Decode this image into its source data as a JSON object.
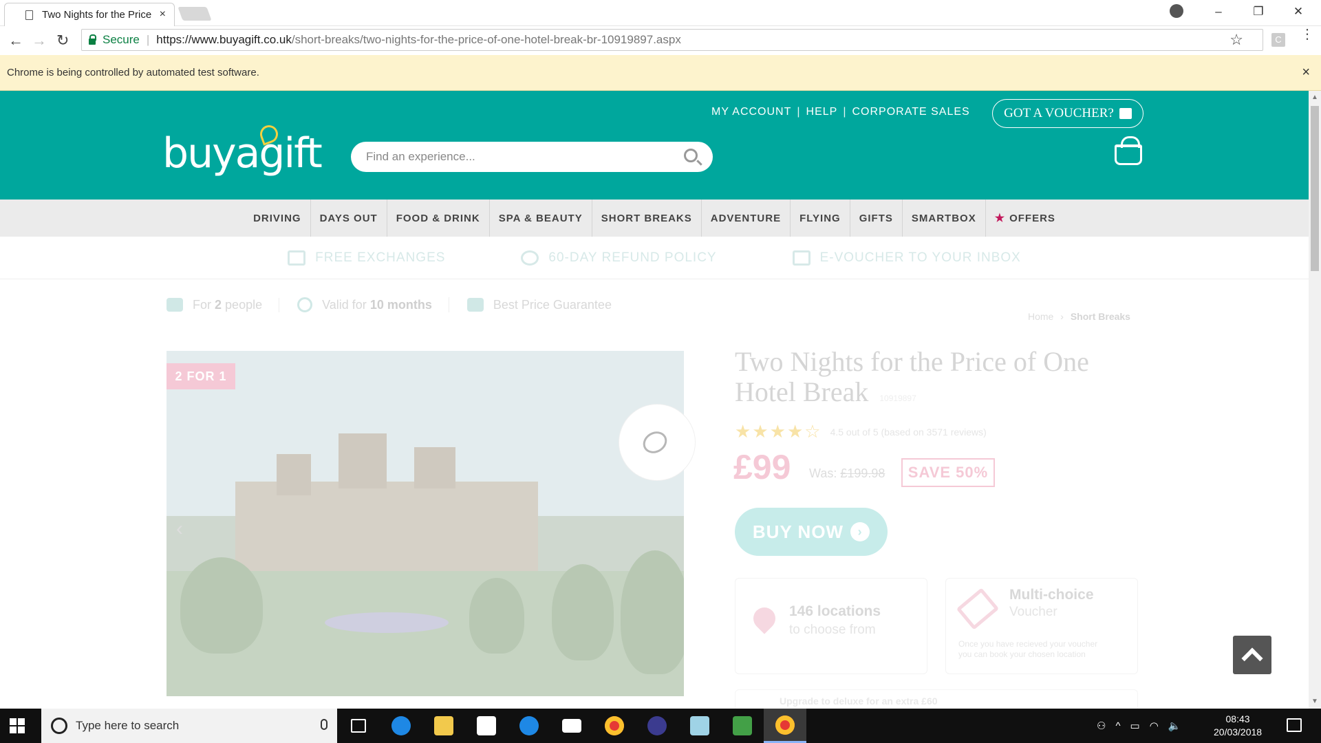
{
  "browser": {
    "tab_title": "Two Nights for the Price",
    "tab_close": "×",
    "secure_label": "Secure",
    "url_host": "https://www.buyagift.co.uk",
    "url_path": "/short-breaks/two-nights-for-the-price-of-one-hotel-break-br-10919897.aspx",
    "ext_label": "C",
    "infobar_text": "Chrome is being controlled by automated test software.",
    "infobar_close": "×",
    "window_controls": {
      "minimize": "–",
      "restore": "❐",
      "close": "✕"
    },
    "nav": {
      "back": "←",
      "forward": "→",
      "reload": "↻",
      "star": "☆"
    }
  },
  "header": {
    "top_links": [
      "MY ACCOUNT",
      "HELP",
      "CORPORATE SALES"
    ],
    "voucher_button": "GOT A VOUCHER?",
    "logo_text": "buyagift",
    "search_placeholder": "Find an experience..."
  },
  "categories": [
    "DRIVING",
    "DAYS OUT",
    "FOOD & DRINK",
    "SPA & BEAUTY",
    "SHORT BREAKS",
    "ADVENTURE",
    "FLYING",
    "GIFTS",
    "SMARTBOX",
    "OFFERS"
  ],
  "usps": [
    "FREE EXCHANGES",
    "60-DAY REFUND POLICY",
    "E-VOUCHER TO YOUR INBOX"
  ],
  "meta": {
    "people_prefix": "For",
    "people_count": "2",
    "people_suffix": "people",
    "valid_prefix": "Valid for",
    "valid_value": "10 months",
    "price_guarantee": "Best Price Guarantee"
  },
  "breadcrumb": {
    "home": "Home",
    "sep": "›",
    "current": "Short Breaks"
  },
  "product": {
    "badge": "2 FOR 1",
    "title": "Two Nights for the Price of One Hotel Break",
    "code": "10919897",
    "rating_text": "4.5 out of 5 (based on 3571 reviews)",
    "rating": 4.5,
    "price": "£99",
    "was_label": "Was:",
    "was_price": "£199.98",
    "save": "SAVE 50%",
    "buy_now": "BUY NOW",
    "locations_big": "146 locations",
    "locations_small": "to choose from",
    "voucher_big": "Multi-choice",
    "voucher_small": "Voucher",
    "voucher_note": "Once you have recieved your voucher you can book your chosen location",
    "upgrade_text": "Upgrade to deluxe for an extra £60"
  },
  "taskbar": {
    "search_placeholder": "Type here to search",
    "time": "08:43",
    "date": "20/03/2018",
    "apps": [
      "task-view",
      "edge",
      "file-explorer",
      "store",
      "app-blue",
      "mail",
      "chrome",
      "app-eclipse",
      "app-notepad",
      "app-green",
      "chrome-active"
    ]
  },
  "colors": {
    "brand_teal": "#00a79d",
    "offer_pink": "#c2185b",
    "infobar": "#fdf3cd"
  }
}
